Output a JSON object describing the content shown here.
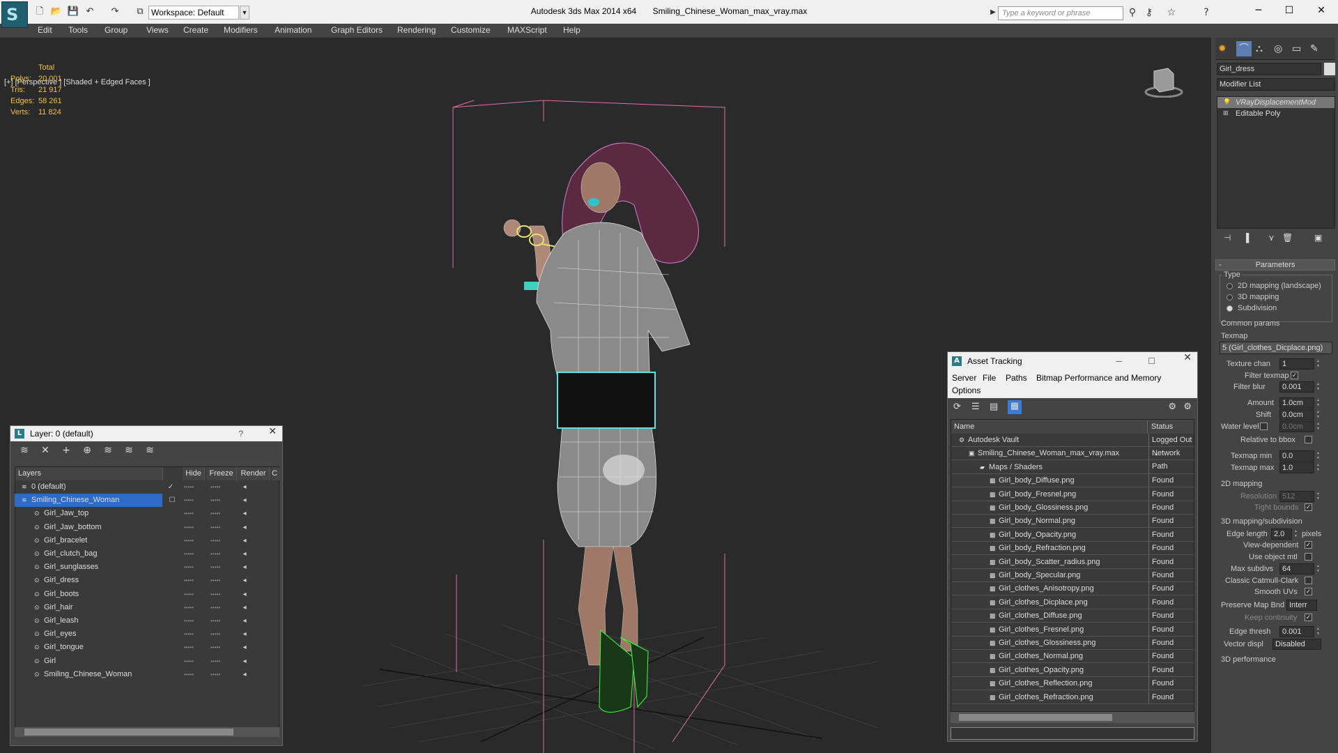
{
  "app": {
    "title": "Autodesk 3ds Max  2014 x64",
    "file": "Smiling_Chinese_Woman_max_vray.max",
    "workspace": "Workspace: Default",
    "search_placeholder": "Type a keyword or phrase"
  },
  "menu": [
    "Edit",
    "Tools",
    "Group",
    "Views",
    "Create",
    "Modifiers",
    "Animation",
    "Graph Editors",
    "Rendering",
    "Customize",
    "MAXScript",
    "Help"
  ],
  "viewport": {
    "label": "[+] [Perspective ] [Shaded + Edged Faces ]",
    "stats": {
      "header": "Total",
      "rows": [
        {
          "k": "Polys:",
          "v": "20 001"
        },
        {
          "k": "Tris:",
          "v": "21 917"
        },
        {
          "k": "Edges:",
          "v": "58 261"
        },
        {
          "k": "Verts:",
          "v": "11 824"
        }
      ]
    }
  },
  "layer_panel": {
    "title": "Layer: 0 (default)",
    "help": "?",
    "columns": {
      "name": "Layers",
      "hide": "Hide",
      "freeze": "Freeze",
      "render": "Render",
      "color": "C"
    },
    "rows": [
      {
        "name": "0 (default)"
      },
      {
        "name": "Smiling_Chinese_Woman"
      },
      {
        "name": "Girl_Jaw_top"
      },
      {
        "name": "Girl_Jaw_bottom"
      },
      {
        "name": "Girl_bracelet"
      },
      {
        "name": "Girl_clutch_bag"
      },
      {
        "name": "Girl_sunglasses"
      },
      {
        "name": "Girl_dress"
      },
      {
        "name": "Girl_boots"
      },
      {
        "name": "Girl_hair"
      },
      {
        "name": "Girl_leash"
      },
      {
        "name": "Girl_eyes"
      },
      {
        "name": "Girl_tongue"
      },
      {
        "name": "Girl"
      },
      {
        "name": "Smiling_Chinese_Woman"
      }
    ]
  },
  "asset_panel": {
    "title": "Asset Tracking",
    "menu": [
      "Server",
      "File",
      "Paths",
      "Bitmap Performance and Memory",
      "Options"
    ],
    "columns": {
      "name": "Name",
      "status": "Status"
    },
    "rows": [
      {
        "name": "Autodesk Vault",
        "status": "Logged Out ..."
      },
      {
        "name": "Smiling_Chinese_Woman_max_vray.max",
        "status": "Network Path"
      },
      {
        "name": "Maps / Shaders",
        "status": ""
      },
      {
        "name": "Girl_body_Diffuse.png",
        "status": "Found"
      },
      {
        "name": "Girl_body_Fresnel.png",
        "status": "Found"
      },
      {
        "name": "Girl_body_Glossiness.png",
        "status": "Found"
      },
      {
        "name": "Girl_body_Normal.png",
        "status": "Found"
      },
      {
        "name": "Girl_body_Opacity.png",
        "status": "Found"
      },
      {
        "name": "Girl_body_Refraction.png",
        "status": "Found"
      },
      {
        "name": "Girl_body_Scatter_radius.png",
        "status": "Found"
      },
      {
        "name": "Girl_body_Specular.png",
        "status": "Found"
      },
      {
        "name": "Girl_clothes_Anisotropy.png",
        "status": "Found"
      },
      {
        "name": "Girl_clothes_Dicplace.png",
        "status": "Found"
      },
      {
        "name": "Girl_clothes_Diffuse.png",
        "status": "Found"
      },
      {
        "name": "Girl_clothes_Fresnel.png",
        "status": "Found"
      },
      {
        "name": "Girl_clothes_Glossiness.png",
        "status": "Found"
      },
      {
        "name": "Girl_clothes_Normal.png",
        "status": "Found"
      },
      {
        "name": "Girl_clothes_Opacity.png",
        "status": "Found"
      },
      {
        "name": "Girl_clothes_Reflection.png",
        "status": "Found"
      },
      {
        "name": "Girl_clothes_Refraction.png",
        "status": "Found"
      }
    ]
  },
  "command_panel": {
    "object_name": "Girl_dress",
    "modifier_list": "Modifier List",
    "stack": [
      "VRayDisplacementMod",
      "Editable Poly"
    ],
    "parameters": "Parameters",
    "type_label": "Type",
    "types": [
      "2D mapping (landscape)",
      "3D mapping",
      "Subdivision"
    ],
    "common_params": "Common params",
    "texmap_label": "Texmap",
    "texmap_value": "5 (Girl_clothes_Dicplace.png)",
    "texture_chan_label": "Texture chan",
    "texture_chan": "1",
    "filter_texmap": "Filter texmap",
    "filter_blur_label": "Filter blur",
    "filter_blur": "0.001",
    "amount_label": "Amount",
    "amount": "1.0cm",
    "shift_label": "Shift",
    "shift": "0.0cm",
    "water_level_label": "Water level",
    "water_level": "0.0cm",
    "relative_bbox": "Relative to bbox",
    "texmap_min_label": "Texmap min",
    "texmap_min": "0.0",
    "texmap_max_label": "Texmap max",
    "texmap_max": "1.0",
    "mapping2d": "2D mapping",
    "resolution_label": "Resolution",
    "resolution": "512",
    "tight_bounds": "Tight bounds",
    "mapping3d": "3D mapping/subdivision",
    "edge_length_label": "Edge length",
    "edge_length": "2.0",
    "pixels": "pixels",
    "view_dependent": "View-dependent",
    "use_object_mtl": "Use object mtl",
    "max_subdivs_label": "Max subdivs",
    "max_subdivs": "64",
    "classic_catmull": "Classic Catmull-Clark",
    "smooth_uvs": "Smooth UVs",
    "preserve_map_bnd_label": "Preserve Map Bnd",
    "preserve_map_bnd": "Interr",
    "keep_continuity": "Keep continuity",
    "edge_thresh_label": "Edge thresh",
    "edge_thresh": "0.001",
    "vector_displ_label": "Vector displ",
    "vector_displ": "Disabled",
    "performance": "3D performance"
  }
}
